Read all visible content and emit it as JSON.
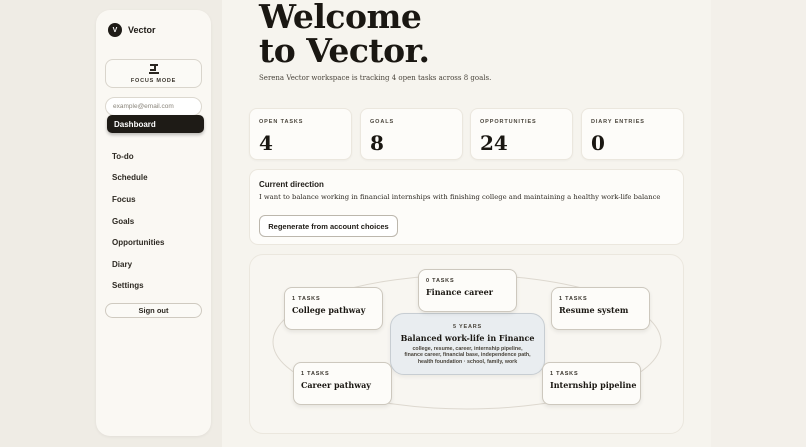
{
  "brand": {
    "logo_letter": "V",
    "name": "Vector"
  },
  "sidebar": {
    "focus_label": "FOCUS MODE",
    "email_placeholder": "example@email.com",
    "items": [
      {
        "label": "Dashboard",
        "active": true
      },
      {
        "label": "To-do"
      },
      {
        "label": "Schedule"
      },
      {
        "label": "Focus"
      },
      {
        "label": "Goals"
      },
      {
        "label": "Opportunities"
      },
      {
        "label": "Diary"
      },
      {
        "label": "Settings"
      }
    ],
    "signout_label": "Sign out"
  },
  "header": {
    "title_line1": "Welcome",
    "title_line2": "to Vector.",
    "subtitle": "Serena Vector workspace is tracking 4 open tasks across 8 goals."
  },
  "stats": [
    {
      "label": "OPEN TASKS",
      "value": "4"
    },
    {
      "label": "GOALS",
      "value": "8"
    },
    {
      "label": "OPPORTUNITIES",
      "value": "24"
    },
    {
      "label": "DIARY ENTRIES",
      "value": "0"
    }
  ],
  "direction": {
    "title": "Current direction",
    "text": "I want to balance working in financial internships with finishing college and maintaining a healthy work-life balance",
    "button": "Regenerate from account choices"
  },
  "map": {
    "center": {
      "duration": "5 YEARS",
      "title": "Balanced work-life in Finance",
      "keywords": "college, resume, career, internship pipeline, finance career, financial base, independence path, health foundation · school, family, work"
    },
    "nodes": [
      {
        "count": "1 TASKS",
        "title": "College pathway"
      },
      {
        "count": "0 TASKS",
        "title": "Finance career"
      },
      {
        "count": "1 TASKS",
        "title": "Resume system"
      },
      {
        "count": "1 TASKS",
        "title": "Career pathway"
      },
      {
        "count": "1 TASKS",
        "title": "Internship pipeline"
      }
    ]
  },
  "colors": {
    "accent": "#1e1b16",
    "center_node": "#e9edf0",
    "background": "#f6f4ee"
  }
}
